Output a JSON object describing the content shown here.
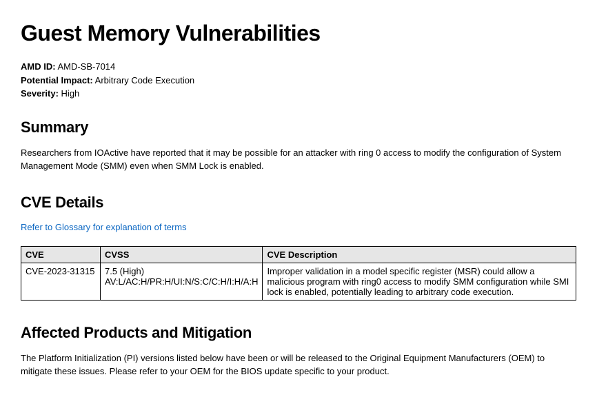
{
  "title": "Guest Memory Vulnerabilities",
  "meta": {
    "amd_id_label": "AMD ID:",
    "amd_id_value": "AMD-SB-7014",
    "impact_label": "Potential Impact:",
    "impact_value": "Arbitrary Code Execution",
    "severity_label": "Severity:",
    "severity_value": "High"
  },
  "summary": {
    "heading": "Summary",
    "text": "Researchers from IOActive have reported that it may be possible for an attacker with ring 0 access to modify the configuration of System Management Mode (SMM) even when SMM Lock is enabled."
  },
  "cve": {
    "heading": "CVE Details",
    "glossary_link": "Refer to Glossary for explanation of terms",
    "headers": {
      "c1": "CVE",
      "c2": "CVSS",
      "c3": "CVE Description"
    },
    "rows": [
      {
        "id": "CVE-2023-31315",
        "score": "7.5 (High)",
        "vector": "AV:L/AC:H/PR:H/UI:N/S:C/C:H/I:H/A:H",
        "desc": "Improper validation in a model specific register (MSR) could allow a malicious program with ring0 access to modify SMM configuration while SMI lock is enabled, potentially leading to arbitrary code execution."
      }
    ]
  },
  "affected": {
    "heading": "Affected Products and Mitigation",
    "text": "The Platform Initialization (PI) versions listed below have been or will be released to the Original Equipment Manufacturers (OEM) to mitigate these issues.  Please refer to your OEM for the BIOS update specific to your product."
  }
}
